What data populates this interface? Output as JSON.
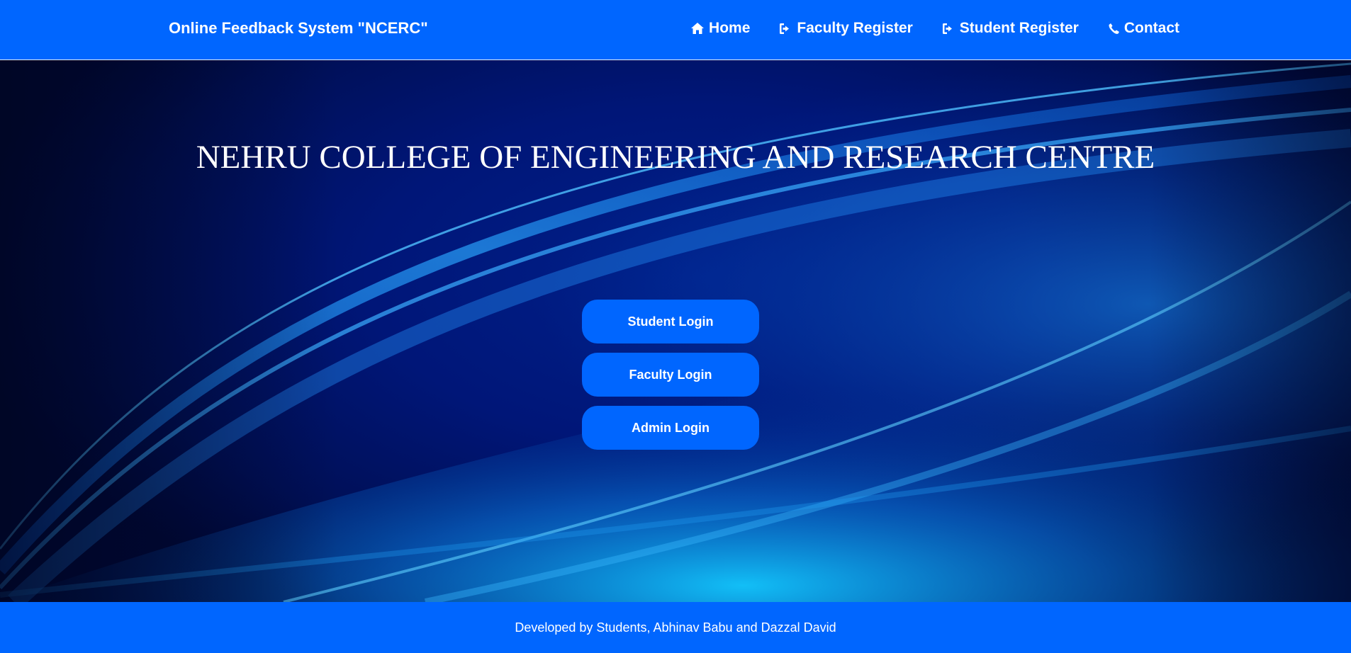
{
  "navbar": {
    "brand": "Online Feedback System \"NCERC\"",
    "links": [
      {
        "label": "Home",
        "icon": "home-icon"
      },
      {
        "label": "Faculty Register",
        "icon": "sign-in-icon"
      },
      {
        "label": "Student Register",
        "icon": "sign-in-icon"
      },
      {
        "label": "Contact",
        "icon": "phone-icon"
      }
    ]
  },
  "hero": {
    "title": "NEHRU COLLEGE OF ENGINEERING AND RESEARCH CENTRE",
    "buttons": [
      {
        "label": "Student Login"
      },
      {
        "label": "Faculty Login"
      },
      {
        "label": "Admin Login"
      }
    ]
  },
  "footer": {
    "text": "Developed by Students, Abhinav Babu and Dazzal David"
  },
  "colors": {
    "primary": "#0066ff",
    "hero_dark": "#000f55",
    "text": "#ffffff"
  }
}
